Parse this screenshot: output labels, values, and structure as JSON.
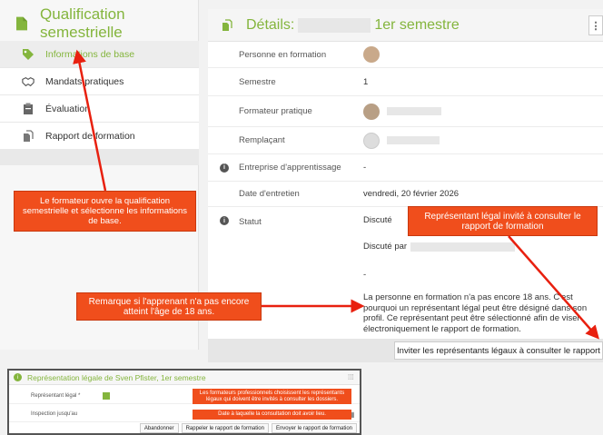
{
  "left_panel": {
    "title": "Qualification semestrielle",
    "items": [
      {
        "label": "Informations de base",
        "icon": "tag-icon"
      },
      {
        "label": "Mandats pratiques",
        "icon": "handshake-icon"
      },
      {
        "label": "Évaluation",
        "icon": "clipboard-icon"
      },
      {
        "label": "Rapport de formation",
        "icon": "report-icon"
      }
    ]
  },
  "details": {
    "title_prefix": "Détails:",
    "title_suffix": "1er semestre",
    "menu_icon": "kebab-menu-icon",
    "rows": {
      "person": {
        "label": "Personne en formation"
      },
      "semester": {
        "label": "Semestre",
        "value": "1"
      },
      "trainer": {
        "label": "Formateur pratique"
      },
      "substitute": {
        "label": "Remplaçant"
      },
      "company": {
        "label": "Entreprise d'apprentissage",
        "value": "-"
      },
      "interview": {
        "label": "Date d'entretien",
        "value": "vendredi, 20 février 2026"
      },
      "status": {
        "label": "Statut",
        "value": "Discuté",
        "by": "Discuté par",
        "dash": "-"
      }
    },
    "minor_note": "La personne en formation n'a pas encore 18 ans. C'est pourquoi un représentant légal peut être désigné dans son profil. Ce représentant peut être sélectionné afin de viser électroniquement le rapport de formation.",
    "invite_button": "Inviter les représentants légaux à consulter le rapport"
  },
  "callouts": {
    "basic_info": "Le formateur ouvre la qualification semestrielle et sélectionne les informations de base.",
    "legal_rep": "Représentant légal invité à consulter le rapport de formation",
    "minor": "Remarque si l'apprenant n'a pas encore atteint l'âge de 18 ans."
  },
  "dialog": {
    "title": "Représentation légale de Sven Pfister, 1er semestre",
    "rep_label": "Représentant légal *",
    "inspection_label": "Inspection jusqu'au",
    "callout_rep": "Les formateurs professionnels choisissent les représentants légaux qui doivent être invités à consulter les dossiers.",
    "callout_date": "Date à laquelle la consultation doit avoir lieu.",
    "btn_cancel": "Abandonner",
    "btn_remind": "Rappeler le rapport de formation",
    "btn_send": "Envoyer le rapport de formation"
  },
  "colors": {
    "accent": "#84b53d",
    "callout": "#f04e1c",
    "arrow": "#e8200f"
  }
}
